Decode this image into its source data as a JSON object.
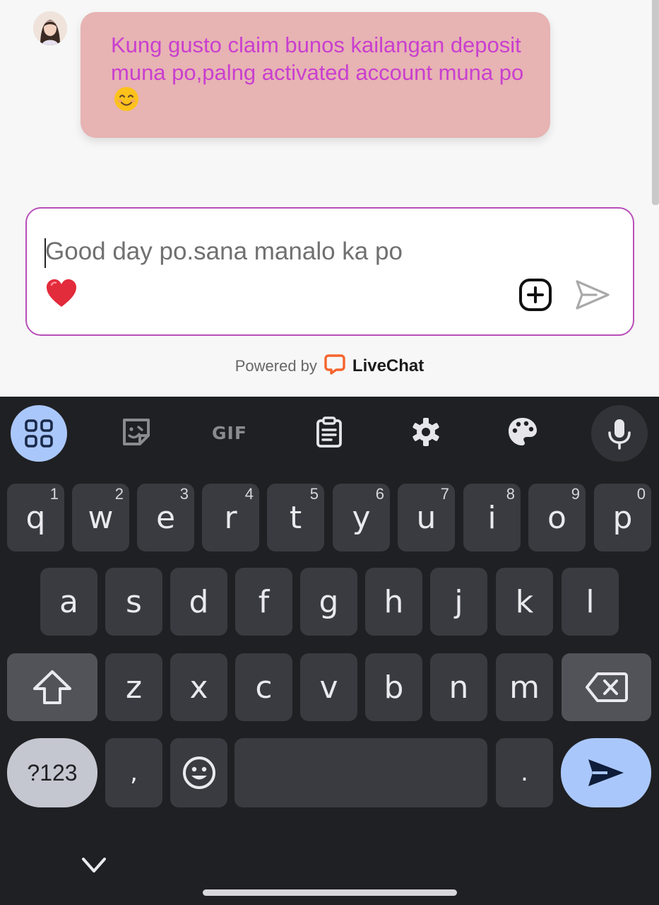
{
  "chat": {
    "agent_message": "Kung gusto claim bunos kailangan deposit muna po,palng activated account muna po",
    "agent_message_emoji": "😊",
    "colors": {
      "bubble": "#e7b3b3",
      "bubble_text": "#c93fcf",
      "composer_border": "#b84fb8"
    }
  },
  "composer": {
    "text": "Good day po.sana manalo ka po",
    "heart_icon": "heart-emoji-icon",
    "attach_icon": "plus-square-icon",
    "send_icon": "send-arrow-icon"
  },
  "footer": {
    "powered_by": "Powered by",
    "brand": "LiveChat",
    "brand_color": "#f5642d"
  },
  "keyboard": {
    "toolbar": [
      "apps-grid-icon",
      "sticker-icon",
      "GIF",
      "clipboard-icon",
      "settings-gear-icon",
      "palette-icon",
      "microphone-icon"
    ],
    "gif_label": "GIF",
    "row1": [
      {
        "k": "q",
        "h": "1"
      },
      {
        "k": "w",
        "h": "2"
      },
      {
        "k": "e",
        "h": "3"
      },
      {
        "k": "r",
        "h": "4"
      },
      {
        "k": "t",
        "h": "5"
      },
      {
        "k": "y",
        "h": "6"
      },
      {
        "k": "u",
        "h": "7"
      },
      {
        "k": "i",
        "h": "8"
      },
      {
        "k": "o",
        "h": "9"
      },
      {
        "k": "p",
        "h": "0"
      }
    ],
    "row2": [
      "a",
      "s",
      "d",
      "f",
      "g",
      "h",
      "j",
      "k",
      "l"
    ],
    "row3": [
      "z",
      "x",
      "c",
      "v",
      "b",
      "n",
      "m"
    ],
    "row4": {
      "symbols": "?123",
      "comma": ",",
      "period": "."
    },
    "accent": "#aac7fb"
  }
}
